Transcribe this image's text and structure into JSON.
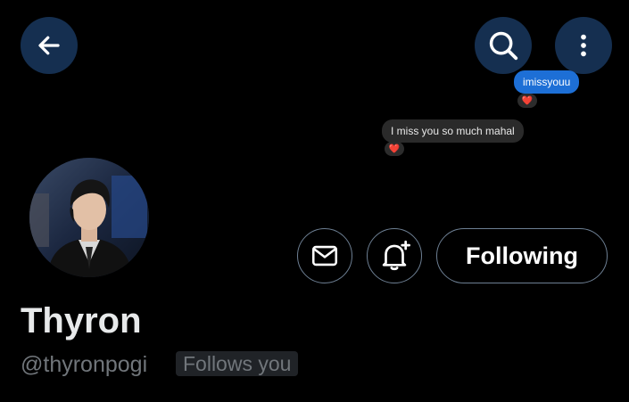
{
  "header": {
    "back_icon": "arrow-left-icon",
    "search_icon": "search-icon",
    "more_icon": "more-vertical-icon"
  },
  "overlay_messages": [
    {
      "text": "imissyouu",
      "reaction": "❤️",
      "bubble_color": "#1d6fd6"
    },
    {
      "text": "I miss you so much mahal",
      "reaction": "❤️",
      "bubble_color": "#2a2a2a"
    }
  ],
  "profile": {
    "display_name": "Thyron",
    "handle": "@thyronpogi",
    "follows_you_badge": "Follows you"
  },
  "actions": {
    "message_icon": "mail-icon",
    "notify_icon": "bell-plus-icon",
    "following_label": "Following"
  },
  "colors": {
    "background": "#000000",
    "header_button": "#152f50",
    "outline": "#6d7f93",
    "name_text": "#e7e9ea",
    "secondary_text": "#71767b"
  }
}
